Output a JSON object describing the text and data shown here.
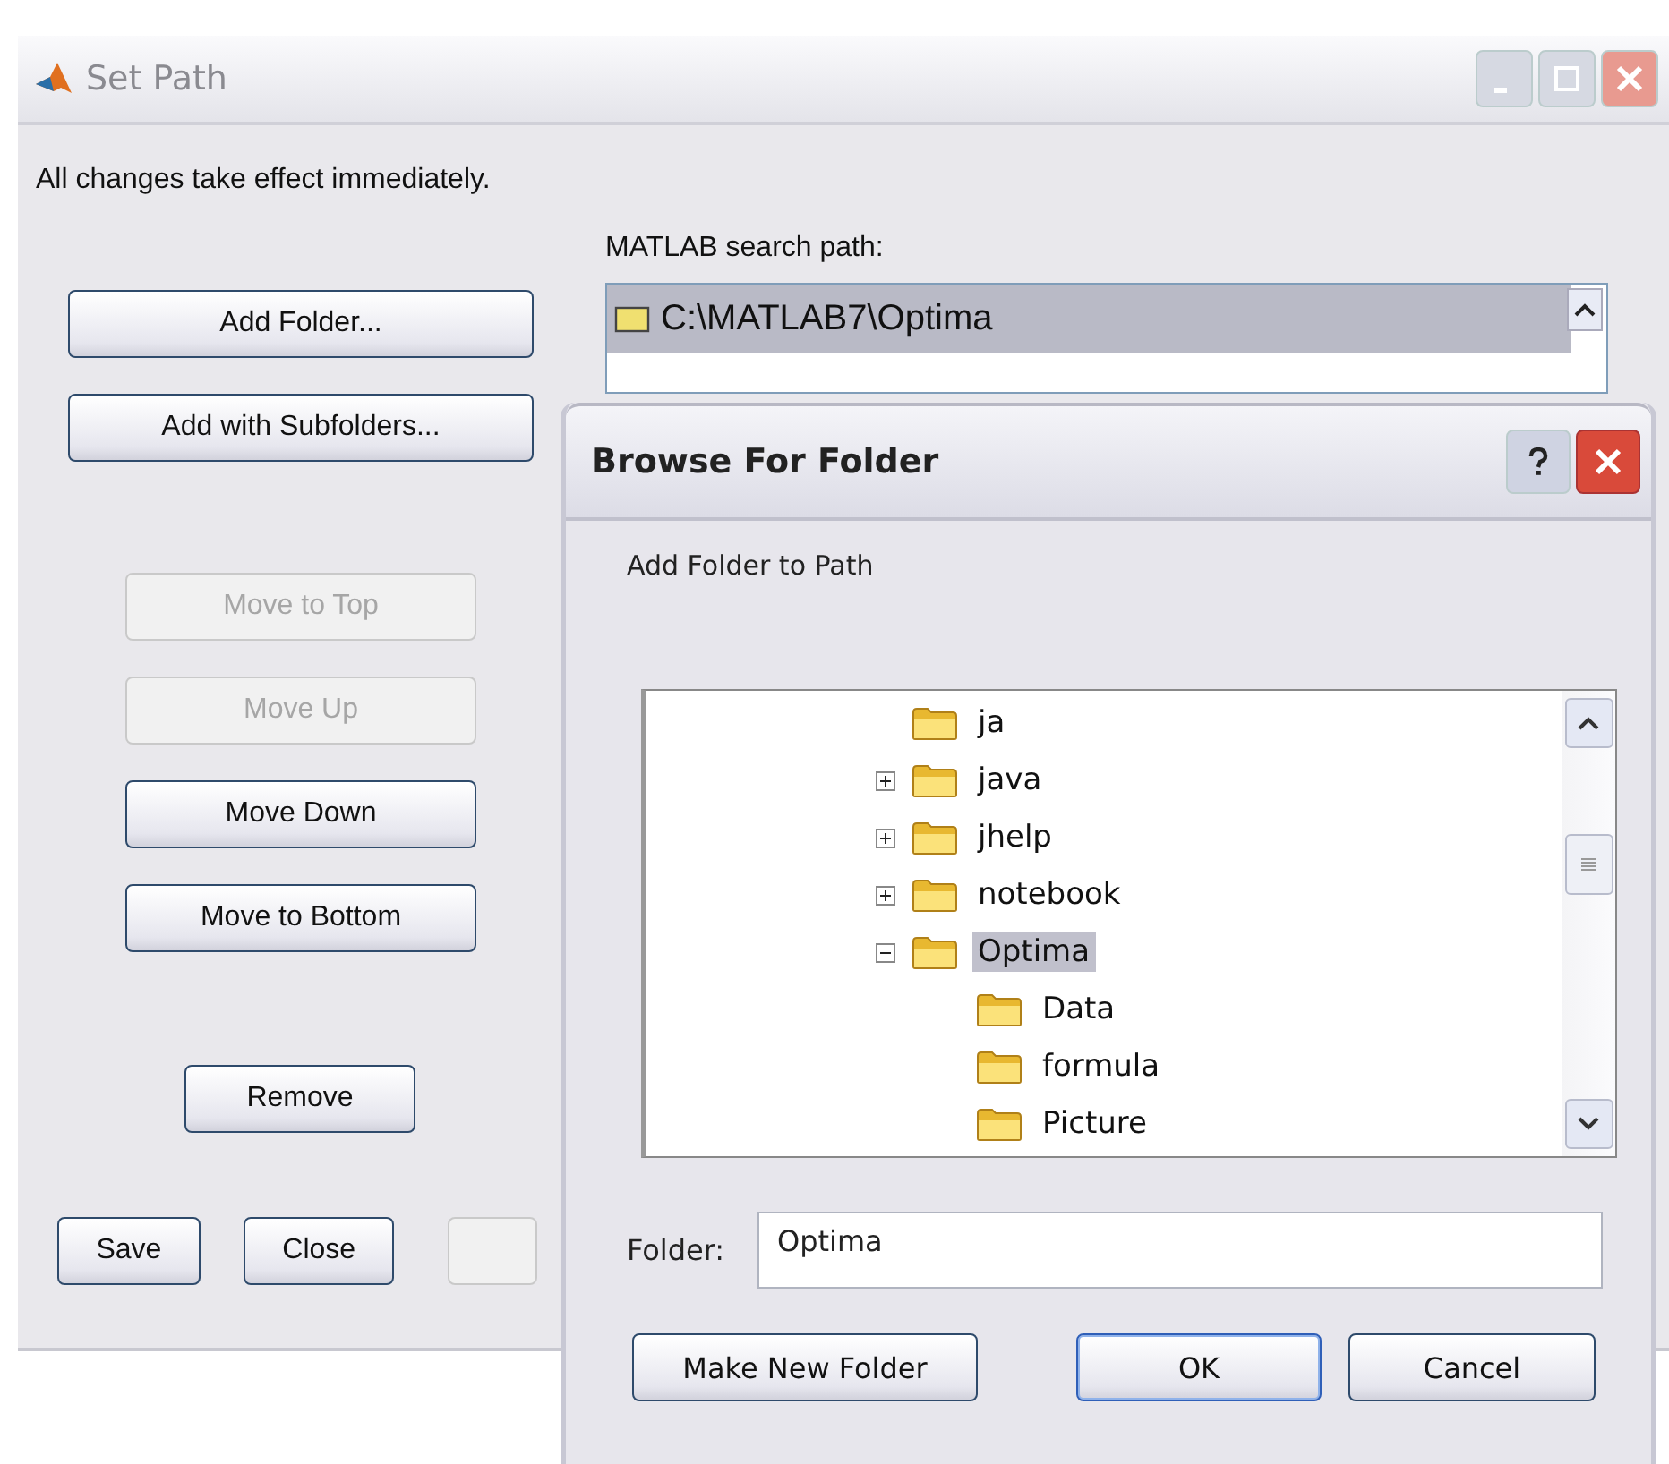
{
  "main_window": {
    "title": "Set Path",
    "notice": "All changes take effect immediately.",
    "path_label": "MATLAB search path:",
    "path_list": [
      {
        "text": "C:\\MATLAB7\\Optima",
        "selected": true
      }
    ],
    "side_buttons": [
      {
        "label": "Add Folder...",
        "disabled": false
      },
      {
        "label": "Add with Subfolders...",
        "disabled": false
      },
      {
        "label": "Move to Top",
        "disabled": true
      },
      {
        "label": "Move Up",
        "disabled": true
      },
      {
        "label": "Move Down",
        "disabled": false
      },
      {
        "label": "Move to Bottom",
        "disabled": false
      },
      {
        "label": "Remove",
        "disabled": false
      }
    ],
    "bottom_buttons": [
      {
        "label": "Save"
      },
      {
        "label": "Close"
      }
    ]
  },
  "dialog": {
    "title": "Browse For Folder",
    "prompt": "Add Folder to Path",
    "tree": [
      {
        "label": "ja",
        "expandable": false,
        "selected": false
      },
      {
        "label": "java",
        "expandable": true,
        "expanded": false,
        "selected": false
      },
      {
        "label": "jhelp",
        "expandable": true,
        "expanded": false,
        "selected": false
      },
      {
        "label": "notebook",
        "expandable": true,
        "expanded": false,
        "selected": false
      },
      {
        "label": "Optima",
        "expandable": true,
        "expanded": true,
        "selected": true,
        "children": [
          {
            "label": "Data",
            "expandable": false,
            "selected": false
          },
          {
            "label": "formula",
            "expandable": false,
            "selected": false
          },
          {
            "label": "Picture",
            "expandable": false,
            "selected": false
          }
        ]
      }
    ],
    "folder_label": "Folder:",
    "folder_value": "Optima",
    "buttons": [
      {
        "label": "Make New Folder",
        "default": false
      },
      {
        "label": "OK",
        "default": true
      },
      {
        "label": "Cancel",
        "default": false
      }
    ]
  }
}
